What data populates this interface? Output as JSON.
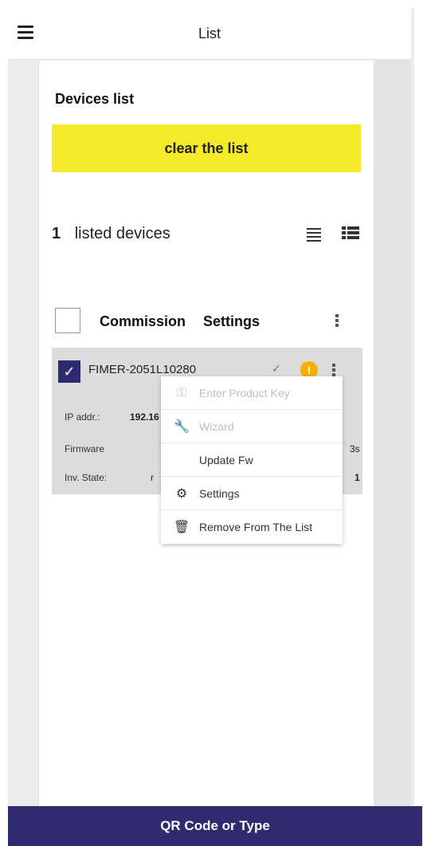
{
  "header": {
    "title": "List"
  },
  "devices_section": {
    "title": "Devices list",
    "clear_button": "clear the list",
    "count": "1",
    "count_label": "listed devices"
  },
  "table": {
    "col_commission": "Commission",
    "col_settings": "Settings"
  },
  "device": {
    "name": "FIMER-2051L10280",
    "fields": [
      {
        "label": "IP addr.:",
        "value": "192.16"
      },
      {
        "label": "Firmware",
        "value": "",
        "suffix": "3s"
      },
      {
        "label": "Inv. State:",
        "value": "r",
        "suffix": "1"
      }
    ]
  },
  "context_menu": {
    "items": [
      {
        "label": "Enter Product Key",
        "icon": "key-icon",
        "enabled": false
      },
      {
        "label": "Wizard",
        "icon": "wrench-icon",
        "enabled": false
      },
      {
        "label": "Update Fw",
        "icon": "",
        "enabled": true
      },
      {
        "label": "Settings",
        "icon": "gear-icon",
        "enabled": true
      },
      {
        "label": "Remove From The List",
        "icon": "trash-icon",
        "enabled": true
      }
    ]
  },
  "bottom_bar": {
    "label": "QR Code or Type"
  },
  "colors": {
    "accent_yellow": "#f4ea2a",
    "primary_navy": "#2f2b6e",
    "success_green": "#3a9a3a",
    "warning_orange": "#f5b000"
  }
}
